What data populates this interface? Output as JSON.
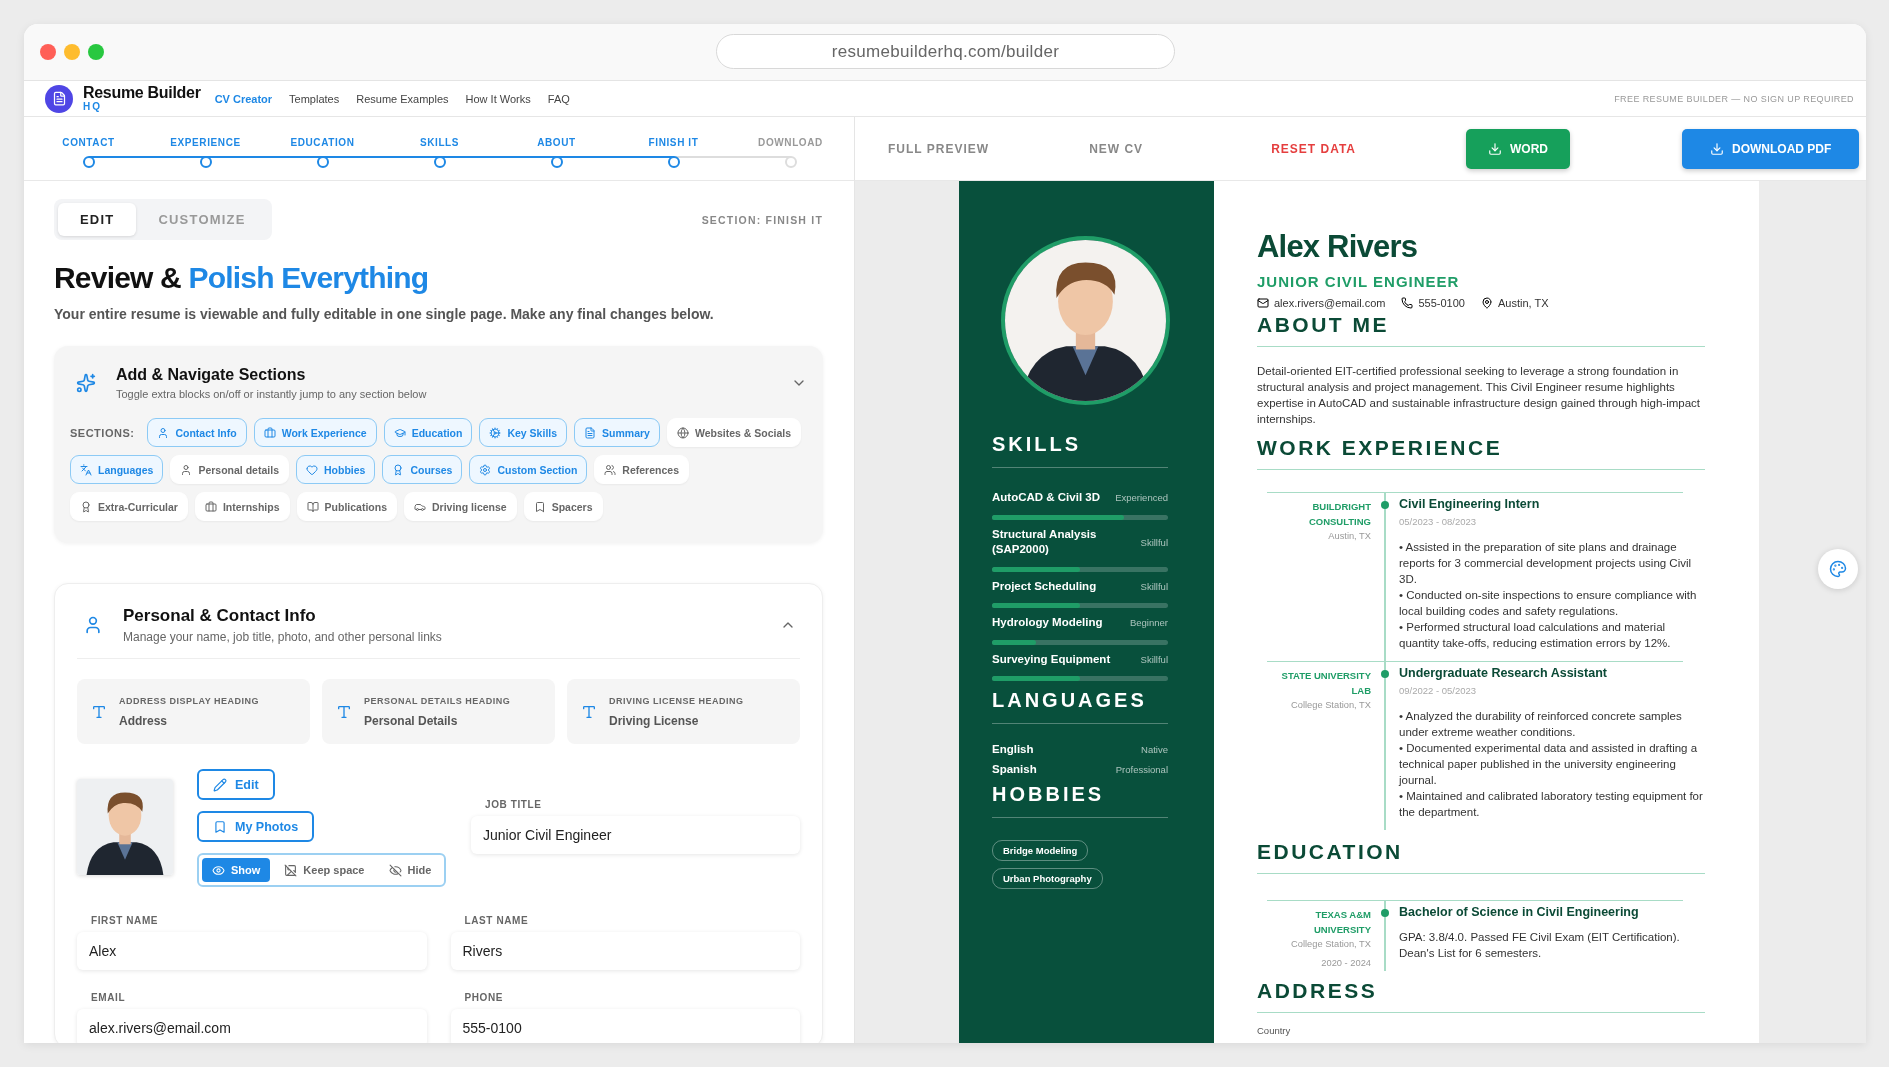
{
  "browser": {
    "url": "resumebuilderhq.com/builder"
  },
  "header": {
    "brand": "Resume Builder",
    "brand_sub": "HQ",
    "tagline": "FREE RESUME BUILDER — NO SIGN UP REQUIRED",
    "nav": [
      {
        "label": "CV Creator",
        "selected": true
      },
      {
        "label": "Templates",
        "selected": false
      },
      {
        "label": "Resume Examples",
        "selected": false
      },
      {
        "label": "How It Works",
        "selected": false
      },
      {
        "label": "FAQ",
        "selected": false
      }
    ]
  },
  "stepper": [
    {
      "label": "CONTACT",
      "done": true
    },
    {
      "label": "EXPERIENCE",
      "done": true
    },
    {
      "label": "EDUCATION",
      "done": true
    },
    {
      "label": "SKILLS",
      "done": true
    },
    {
      "label": "ABOUT",
      "done": true
    },
    {
      "label": "FINISH IT",
      "done": true
    },
    {
      "label": "DOWNLOAD",
      "done": false
    }
  ],
  "mode_tabs": [
    {
      "label": "EDIT",
      "selected": true
    },
    {
      "label": "CUSTOMIZE",
      "selected": false
    }
  ],
  "section_indicator": "SECTION: FINISH IT",
  "title_start": "Review &",
  "title_highlight": "Polish Everything",
  "subtitle": "Your entire resume is viewable and fully editable in one single page. Make any final changes below.",
  "sections_card": {
    "title": "Add & Navigate Sections",
    "subtitle": "Toggle extra blocks on/off or instantly jump to any section below",
    "expanded": false,
    "label": "SECTIONS:",
    "chips": [
      {
        "label": "Contact Info",
        "on": true
      },
      {
        "label": "Work Experience",
        "on": true
      },
      {
        "label": "Education",
        "on": true
      },
      {
        "label": "Key Skills",
        "on": true
      },
      {
        "label": "Summary",
        "on": true
      },
      {
        "label": "Websites & Socials",
        "on": false
      },
      {
        "label": "Languages",
        "on": true
      },
      {
        "label": "Personal details",
        "on": false
      },
      {
        "label": "Hobbies",
        "on": true
      },
      {
        "label": "Courses",
        "on": true
      },
      {
        "label": "Custom Section",
        "on": true
      },
      {
        "label": "References",
        "on": false
      },
      {
        "label": "Extra-Curricular",
        "on": false
      },
      {
        "label": "Internships",
        "on": false
      },
      {
        "label": "Publications",
        "on": false
      },
      {
        "label": "Driving license",
        "on": false
      },
      {
        "label": "Spacers",
        "on": false
      }
    ]
  },
  "personal_card": {
    "title": "Personal & Contact Info",
    "subtitle": "Manage your name, job title, photo, and other personal links",
    "expanded": true,
    "heading_fields": [
      {
        "label": "ADDRESS DISPLAY HEADING",
        "value": "Address"
      },
      {
        "label": "PERSONAL DETAILS HEADING",
        "value": "Personal Details"
      },
      {
        "label": "DRIVING LICENSE HEADING",
        "value": "Driving License"
      }
    ],
    "photo_buttons": [
      "Edit",
      "My Photos"
    ],
    "visibility": [
      {
        "label": "Show",
        "selected": true
      },
      {
        "label": "Keep space",
        "selected": false
      },
      {
        "label": "Hide",
        "selected": false
      }
    ],
    "job_title": {
      "label": "JOB TITLE",
      "value": "Junior Civil Engineer"
    },
    "fields": [
      {
        "label": "FIRST NAME",
        "value": "Alex"
      },
      {
        "label": "LAST NAME",
        "value": "Rivers"
      },
      {
        "label": "EMAIL",
        "value": "alex.rivers@email.com"
      },
      {
        "label": "PHONE",
        "value": "555-0100"
      }
    ]
  },
  "toolbar": [
    {
      "label": "FULL PREVIEW",
      "kind": "link"
    },
    {
      "label": "NEW CV",
      "kind": "link"
    },
    {
      "label": "RESET DATA",
      "kind": "danger"
    },
    {
      "label": "WORD",
      "kind": "word"
    },
    {
      "label": "DOWNLOAD PDF",
      "kind": "pdf"
    }
  ],
  "resume": {
    "skills_heading": "SKILLS",
    "skills": [
      {
        "name": "AutoCAD & Civil 3D",
        "rating": "Experienced",
        "level": 0.75
      },
      {
        "name": "Structural Analysis (SAP2000)",
        "rating": "Skillful",
        "level": 0.5
      },
      {
        "name": "Project Scheduling",
        "rating": "Skillful",
        "level": 0.5
      },
      {
        "name": "Hydrology Modeling",
        "rating": "Beginner",
        "level": 0.25
      },
      {
        "name": "Surveying Equipment",
        "rating": "Skillful",
        "level": 0.5
      }
    ],
    "languages_heading": "LANGUAGES",
    "languages": [
      {
        "name": "English",
        "rating": "Native"
      },
      {
        "name": "Spanish",
        "rating": "Professional"
      }
    ],
    "hobbies_heading": "HOBBIES",
    "hobbies": [
      "Bridge Modeling",
      "Urban Photography"
    ],
    "name": "Alex Rivers",
    "job_title": "JUNIOR CIVIL ENGINEER",
    "contacts": [
      {
        "kind": "email",
        "text": "alex.rivers@email.com"
      },
      {
        "kind": "phone",
        "text": "555-0100"
      },
      {
        "kind": "location",
        "text": "Austin, TX"
      }
    ],
    "about_heading": "ABOUT ME",
    "about": "Detail-oriented EIT-certified professional seeking to leverage a strong foundation in structural analysis and project management. This Civil Engineer resume highlights expertise in AutoCAD and sustainable infrastructure design gained through high-impact internships.",
    "work_heading": "WORK EXPERIENCE",
    "work": [
      {
        "org": "BUILDRIGHT CONSULTING",
        "location": "Austin, TX",
        "title": "Civil Engineering Intern",
        "dates": "05/2023 - 08/2023",
        "bullets": [
          "• Assisted in the preparation of site plans and drainage reports for 3 commercial development projects using Civil 3D.",
          "• Conducted on-site inspections to ensure compliance with local building codes and safety regulations.",
          "• Performed structural load calculations and material quantity take-offs, reducing estimation errors by 12%."
        ]
      },
      {
        "org": "STATE UNIVERSITY LAB",
        "location": "College Station, TX",
        "title": "Undergraduate Research Assistant",
        "dates": "09/2022 - 05/2023",
        "bullets": [
          "• Analyzed the durability of reinforced concrete samples under extreme weather conditions.",
          "• Documented experimental data and assisted in drafting a technical paper published in the university engineering journal.",
          "• Maintained and calibrated laboratory testing equipment for the department."
        ]
      }
    ],
    "education_heading": "EDUCATION",
    "education": [
      {
        "org": "TEXAS A&M UNIVERSITY",
        "location": "College Station, TX",
        "dates": "2020 - 2024",
        "title": "Bachelor of Science in Civil Engineering",
        "description": "GPA: 3.8/4.0. Passed FE Civil Exam (EIT Certification). Dean's List for 6 semesters."
      }
    ],
    "address_heading": "ADDRESS",
    "address_label": "Country"
  }
}
